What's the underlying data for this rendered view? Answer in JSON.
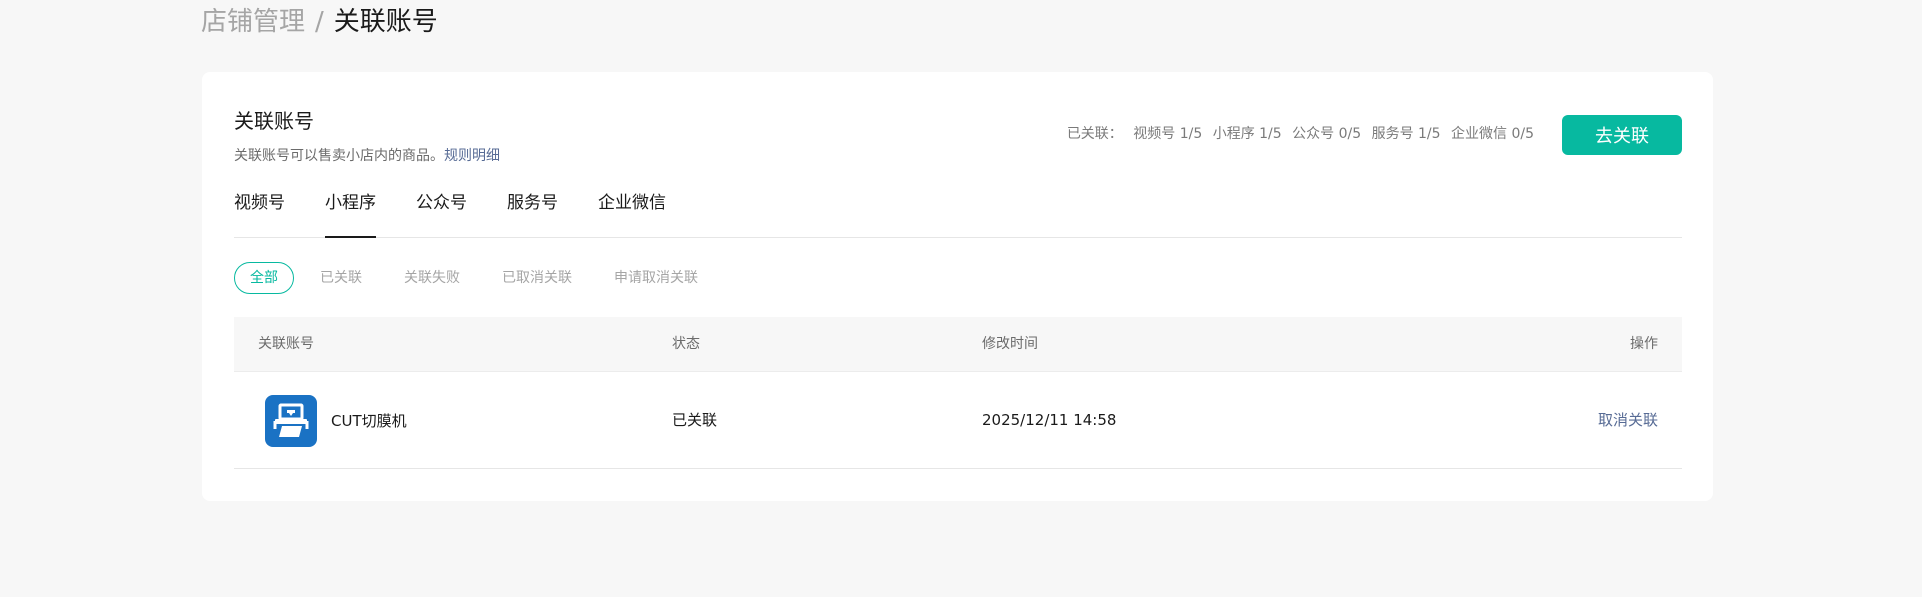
{
  "breadcrumb": {
    "parent": "店铺管理",
    "separator": "/",
    "current": "关联账号"
  },
  "section": {
    "title": "关联账号",
    "description": "关联账号可以售卖小店内的商品。",
    "rules_link": "规则明细"
  },
  "summary": {
    "label": "已关联：",
    "items": [
      "视频号 1/5",
      "小程序 1/5",
      "公众号 0/5",
      "服务号 1/5",
      "企业微信 0/5"
    ]
  },
  "link_button": "去关联",
  "tabs": [
    "视频号",
    "小程序",
    "公众号",
    "服务号",
    "企业微信"
  ],
  "active_tab": "小程序",
  "filters": [
    "全部",
    "已关联",
    "关联失败",
    "已取消关联",
    "申请取消关联"
  ],
  "active_filter": "全部",
  "table": {
    "headers": [
      "关联账号",
      "状态",
      "修改时间",
      "操作"
    ],
    "rows": [
      {
        "account": "CUT切膜机",
        "avatar_icon": "cutting-machine-icon",
        "status": "已关联",
        "modified": "2025/12/11 14:58",
        "action": "取消关联"
      }
    ]
  },
  "colors": {
    "accent": "#07b9a0",
    "link": "#576b95",
    "avatar_bg": "#1a72c4"
  }
}
